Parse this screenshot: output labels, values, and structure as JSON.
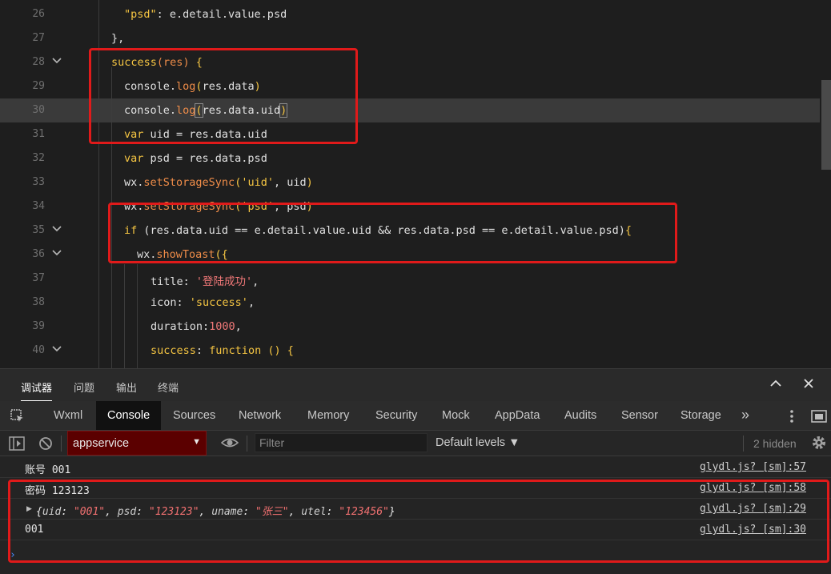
{
  "editor": {
    "current_line": 30,
    "lines": [
      {
        "n": "26",
        "fold": false,
        "indent": 155,
        "tokens": [
          {
            "t": "\"psd\"",
            "c": "t-str"
          },
          {
            "t": ": e.detail.value.psd",
            "c": ""
          }
        ]
      },
      {
        "n": "27",
        "fold": false,
        "indent": 139,
        "tokens": [
          {
            "t": "},",
            "c": ""
          }
        ]
      },
      {
        "n": "28",
        "fold": true,
        "indent": 139,
        "tokens": [
          {
            "t": "success",
            "c": "t-kw"
          },
          {
            "t": "(",
            "c": "t-fn"
          },
          {
            "t": "res",
            "c": "t-fn"
          },
          {
            "t": ")",
            "c": "t-fn"
          },
          {
            "t": " {",
            "c": "t-kw"
          }
        ]
      },
      {
        "n": "29",
        "fold": false,
        "indent": 155,
        "tokens": [
          {
            "t": "console.",
            "c": ""
          },
          {
            "t": "log",
            "c": "t-fn"
          },
          {
            "t": "(",
            "c": "t-kw"
          },
          {
            "t": "res.data",
            "c": ""
          },
          {
            "t": ")",
            "c": "t-kw"
          }
        ]
      },
      {
        "n": "30",
        "fold": false,
        "indent": 155,
        "tokens": [
          {
            "t": "console.",
            "c": ""
          },
          {
            "t": "log",
            "c": "t-fn"
          },
          {
            "t": "(",
            "c": "t-kw t-bracket"
          },
          {
            "t": "res.data.uid",
            "c": ""
          },
          {
            "t": ")",
            "c": "t-kw t-bracket"
          }
        ]
      },
      {
        "n": "31",
        "fold": false,
        "indent": 155,
        "tokens": [
          {
            "t": "var",
            "c": "t-kw"
          },
          {
            "t": " uid = res.data.uid",
            "c": ""
          }
        ]
      },
      {
        "n": "32",
        "fold": false,
        "indent": 155,
        "tokens": [
          {
            "t": "var",
            "c": "t-kw"
          },
          {
            "t": " psd = res.data.psd",
            "c": ""
          }
        ]
      },
      {
        "n": "33",
        "fold": false,
        "indent": 155,
        "tokens": [
          {
            "t": "wx.",
            "c": ""
          },
          {
            "t": "setStorageSync",
            "c": "t-fn"
          },
          {
            "t": "(",
            "c": "t-kw"
          },
          {
            "t": "'uid'",
            "c": "t-str"
          },
          {
            "t": ", uid",
            "c": ""
          },
          {
            "t": ")",
            "c": "t-kw"
          }
        ]
      },
      {
        "n": "34",
        "fold": false,
        "indent": 155,
        "tokens": [
          {
            "t": "wx.",
            "c": ""
          },
          {
            "t": "setStorageSync",
            "c": "t-fn"
          },
          {
            "t": "(",
            "c": "t-kw"
          },
          {
            "t": "'psd'",
            "c": "t-str"
          },
          {
            "t": ", psd",
            "c": ""
          },
          {
            "t": ")",
            "c": "t-kw"
          }
        ]
      },
      {
        "n": "35",
        "fold": true,
        "indent": 155,
        "tokens": [
          {
            "t": "if",
            "c": "t-kw"
          },
          {
            "t": " (res.data.uid == e.detail.value.uid && res.data.psd == e.detail.value.psd)",
            "c": ""
          },
          {
            "t": "{",
            "c": "t-kw"
          }
        ]
      },
      {
        "n": "36",
        "fold": true,
        "indent": 171,
        "tokens": [
          {
            "t": "wx.",
            "c": ""
          },
          {
            "t": "showToast",
            "c": "t-fn"
          },
          {
            "t": "({",
            "c": "t-kw"
          }
        ]
      },
      {
        "n": "37",
        "fold": false,
        "indent": 188,
        "tokens": [
          {
            "t": "title: ",
            "c": ""
          },
          {
            "t": "'登陆成功'",
            "c": "t-red"
          },
          {
            "t": ",",
            "c": ""
          }
        ]
      },
      {
        "n": "38",
        "fold": false,
        "indent": 188,
        "tokens": [
          {
            "t": "icon: ",
            "c": ""
          },
          {
            "t": "'success'",
            "c": "t-str"
          },
          {
            "t": ",",
            "c": ""
          }
        ]
      },
      {
        "n": "39",
        "fold": false,
        "indent": 188,
        "tokens": [
          {
            "t": "duration:",
            "c": ""
          },
          {
            "t": "1000",
            "c": "t-num"
          },
          {
            "t": ",",
            "c": ""
          }
        ]
      },
      {
        "n": "40",
        "fold": true,
        "indent": 188,
        "tokens": [
          {
            "t": "success",
            "c": "t-kw"
          },
          {
            "t": ": ",
            "c": ""
          },
          {
            "t": "function",
            "c": "t-kw"
          },
          {
            "t": " () {",
            "c": "t-kw"
          }
        ]
      }
    ]
  },
  "devtools": {
    "top_tabs": [
      "调试器",
      "问题",
      "输出",
      "终端"
    ],
    "active_top_tab": "调试器",
    "tabs": [
      "Wxml",
      "Console",
      "Sources",
      "Network",
      "Memory",
      "Security",
      "Mock",
      "AppData",
      "Audits",
      "Sensor",
      "Storage"
    ],
    "active_tab": "Console",
    "more_tabs_glyph": "»",
    "context": "appservice",
    "filter_placeholder": "Filter",
    "levels": "Default levels ▼",
    "hidden": "2 hidden"
  },
  "console": {
    "messages": [
      {
        "text": "账号 001",
        "source": "glydl.js? [sm]:57"
      },
      {
        "text": "密码 123123",
        "source": "glydl.js? [sm]:58"
      },
      {
        "source": "glydl.js? [sm]:29",
        "object": [
          {
            "k": "uid",
            "v": "\"001\""
          },
          {
            "k": "psd",
            "v": "\"123123\""
          },
          {
            "k": "uname",
            "v": "\"张三\""
          },
          {
            "k": "utel",
            "v": "\"123456\""
          }
        ]
      },
      {
        "text": "001",
        "source": "glydl.js? [sm]:30"
      }
    ],
    "prompt": "›"
  },
  "colors": {
    "annotation": "#e01a1a",
    "context_bg": "#5b0000",
    "active_tab_bg": "#111111"
  }
}
